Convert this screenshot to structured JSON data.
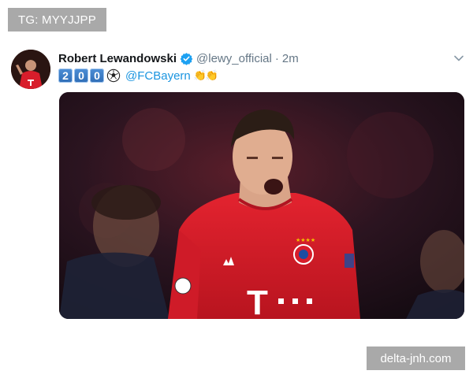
{
  "overlay": {
    "top_tag": "TG: MYYJJPP",
    "watermark": "delta-jnh.com"
  },
  "tweet": {
    "author_name": "Robert Lewandowski",
    "handle": "@lewy_official",
    "separator": "·",
    "time": "2m",
    "verified": true,
    "text": {
      "keycaps": [
        "2",
        "0",
        "0"
      ],
      "emoji_after_keycaps": "soccer-ball-icon",
      "mention": "@FCBayern",
      "trailing_emoji": "👏👏"
    },
    "media": {
      "kind": "photo",
      "shirt_letter": "T",
      "colors": {
        "shirt": "#d81d2b",
        "background": "#1a0e14"
      }
    }
  },
  "colors": {
    "accent_link": "#1b95e0",
    "verified_blue": "#1da1f2",
    "secondary_text": "#657786",
    "badge_grey": "#a9a9a9"
  }
}
